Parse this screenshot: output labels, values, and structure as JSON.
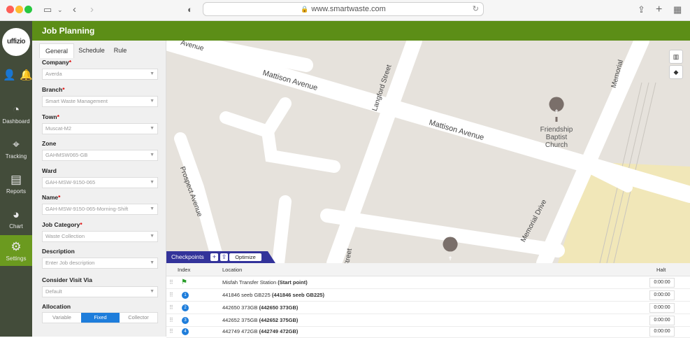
{
  "browser": {
    "url": "www.smartwaste.com"
  },
  "brand": {
    "logo_text": "uffizio"
  },
  "rail": {
    "items": [
      {
        "label": "Dashboard",
        "icon": "gauge-icon"
      },
      {
        "label": "Tracking",
        "icon": "pin-icon"
      },
      {
        "label": "Reports",
        "icon": "document-icon"
      },
      {
        "label": "Chart",
        "icon": "pie-chart-icon"
      },
      {
        "label": "Settings",
        "icon": "gear-icon",
        "active": true
      }
    ]
  },
  "header": {
    "title": "Job Planning"
  },
  "tabs": [
    "General",
    "Schedule",
    "Rule"
  ],
  "form": {
    "company": {
      "label": "Company",
      "value": "Averda"
    },
    "branch": {
      "label": "Branch",
      "value": "Smart Waste Management"
    },
    "town": {
      "label": "Town",
      "value": "Muscat-M2"
    },
    "zone": {
      "label": "Zone",
      "value": "GAHMSW065-GB"
    },
    "ward": {
      "label": "Ward",
      "value": "GAH-MSW-9150-065"
    },
    "name": {
      "label": "Name",
      "value": "GAH-MSW-9150-065-Morning-Shift"
    },
    "job_category": {
      "label": "Job Category",
      "value": "Waste Collection"
    },
    "description": {
      "label": "Description",
      "placeholder": "Enter Job description"
    },
    "consider_visit_via": {
      "label": "Consider Visit Via",
      "value": "Default"
    },
    "allocation": {
      "label": "Allocation",
      "options": [
        "Variable",
        "Fixed",
        "Collector"
      ],
      "selected": "Fixed"
    },
    "required_mark": "*"
  },
  "map": {
    "streets": [
      "Avenue",
      "Mattison Avenue",
      "Mattison Avenue",
      "Langford Street",
      "Prospect Avenue",
      "Memorial Drive",
      "Memorial",
      "Street"
    ],
    "poi": "Friendship Baptist Church",
    "poi_lines": [
      "Friendship",
      "Baptist",
      "Church"
    ]
  },
  "checkpoints": {
    "label": "Checkpoints",
    "add_label": "+",
    "upload_label": "⇪",
    "optimize_label": "Optimize",
    "columns": {
      "index": "Index",
      "location": "Location",
      "halt": "Halt"
    },
    "rows": [
      {
        "index": "",
        "flag": true,
        "location": "Misfah Transfer Station",
        "detail": "(Start point)",
        "halt": "0:00:00"
      },
      {
        "index": "1",
        "location": "441846 seeb GB225",
        "detail": "(441846 seeb GB225)",
        "halt": "0:00:00"
      },
      {
        "index": "2",
        "location": "442650 373GB",
        "detail": "(442650 373GB)",
        "halt": "0:00:00"
      },
      {
        "index": "3",
        "location": "442652 375GB",
        "detail": "(442652 375GB)",
        "halt": "0:00:00"
      },
      {
        "index": "4",
        "location": "442749 472GB",
        "detail": "(442749 472GB)",
        "halt": "0:00:00"
      }
    ]
  }
}
